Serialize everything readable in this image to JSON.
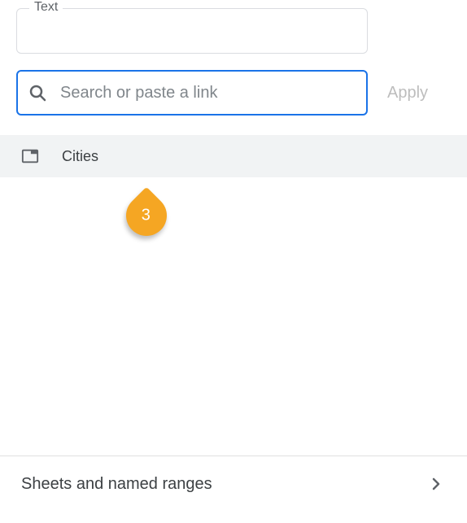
{
  "text_field": {
    "label": "Text",
    "value": ""
  },
  "search_field": {
    "placeholder": "Search or paste a link",
    "value": ""
  },
  "apply_button": {
    "label": "Apply"
  },
  "suggestions": [
    {
      "label": "Cities"
    }
  ],
  "annotation": {
    "number": "3"
  },
  "bottom_row": {
    "label": "Sheets and named ranges"
  }
}
